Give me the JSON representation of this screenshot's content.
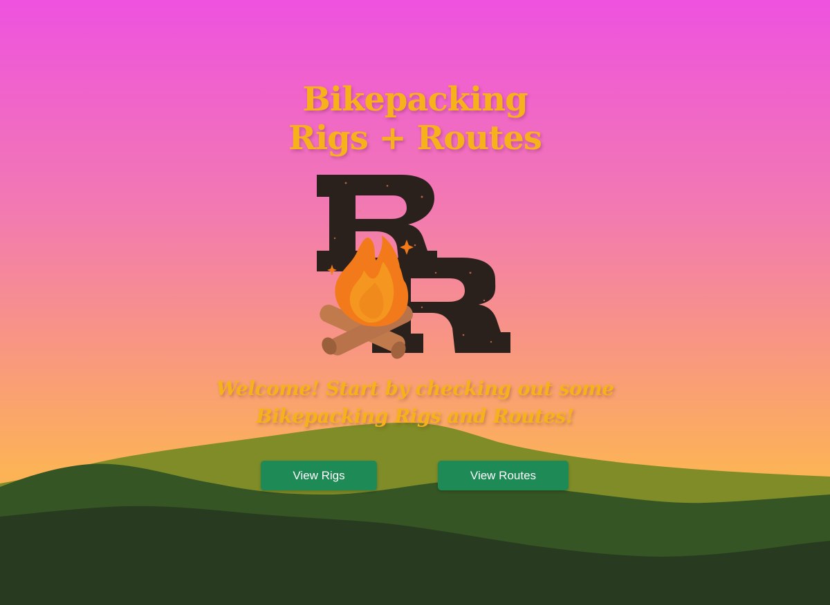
{
  "hero": {
    "title_line1": "Bikepacking",
    "title_line2": "Rigs + Routes",
    "logo_icon": "campfire-rr-logo-icon",
    "tagline_line1": "Welcome! Start by checking out some",
    "tagline_line2": "Bikepacking Rigs and Routes!"
  },
  "actions": {
    "view_rigs_label": "View Rigs",
    "view_routes_label": "View Routes"
  },
  "colors": {
    "sky_top": "#ee52df",
    "sky_bottom": "#fcb356",
    "title": "#f7b21b",
    "button": "#1e8a55",
    "hill_light": "#7f8c27",
    "hill_mid": "#355524",
    "hill_dark": "#283a1f",
    "logo_letters": "#2b211c"
  }
}
